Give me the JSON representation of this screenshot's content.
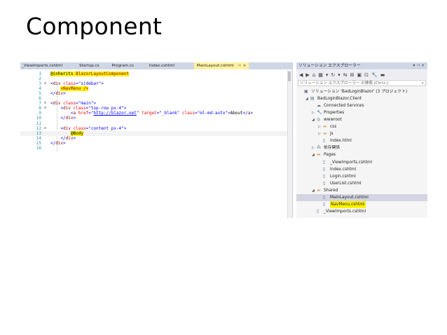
{
  "slide": {
    "title": "Component"
  },
  "editor": {
    "tabs": [
      {
        "label": "_ViewImports.cshtml",
        "active": false
      },
      {
        "label": "Startup.cs",
        "active": false
      },
      {
        "label": "Program.cs",
        "active": false
      },
      {
        "label": "Index.cshtml",
        "active": false
      },
      {
        "label": "MainLayout.cshtml",
        "active": true,
        "pin": "⊣",
        "close": "×"
      }
    ],
    "lines": [
      {
        "n": "1",
        "seg": [
          {
            "t": "@inherits ",
            "c": "kw-dir hl"
          },
          {
            "t": "BlazorLayoutComponent",
            "c": "tag hl"
          }
        ]
      },
      {
        "n": "2",
        "seg": []
      },
      {
        "n": "3",
        "fold": "⊟",
        "seg": [
          {
            "t": "<",
            "c": "str"
          },
          {
            "t": "div",
            "c": "tag"
          },
          {
            "t": " class",
            "c": "attr"
          },
          {
            "t": "=\"sidebar\"",
            "c": "str"
          },
          {
            "t": ">",
            "c": "str"
          }
        ]
      },
      {
        "n": "4",
        "seg": [
          {
            "t": "    ",
            "c": ""
          },
          {
            "t": "<NavMenu />",
            "c": "tag hl"
          }
        ]
      },
      {
        "n": "5",
        "seg": [
          {
            "t": "</",
            "c": "str"
          },
          {
            "t": "div",
            "c": "tag"
          },
          {
            "t": ">",
            "c": "str"
          }
        ]
      },
      {
        "n": "6",
        "seg": []
      },
      {
        "n": "7",
        "fold": "⊟",
        "seg": [
          {
            "t": "<",
            "c": "str"
          },
          {
            "t": "div",
            "c": "tag"
          },
          {
            "t": " class",
            "c": "attr"
          },
          {
            "t": "=\"main\"",
            "c": "str"
          },
          {
            "t": ">",
            "c": "str"
          }
        ]
      },
      {
        "n": "8",
        "fold": "⊟",
        "seg": [
          {
            "t": "    <",
            "c": "str"
          },
          {
            "t": "div",
            "c": "tag"
          },
          {
            "t": " class",
            "c": "attr"
          },
          {
            "t": "=\"top-row px-4\"",
            "c": "str"
          },
          {
            "t": ">",
            "c": "str"
          }
        ]
      },
      {
        "n": "9",
        "seg": [
          {
            "t": "        <",
            "c": "str"
          },
          {
            "t": "a",
            "c": "tag"
          },
          {
            "t": " href",
            "c": "attr"
          },
          {
            "t": "=\"",
            "c": "str"
          },
          {
            "t": "http://blazor.net",
            "c": "lnk"
          },
          {
            "t": "\"",
            "c": "str"
          },
          {
            "t": " target",
            "c": "attr"
          },
          {
            "t": "=\"_blank\"",
            "c": "str"
          },
          {
            "t": " class",
            "c": "attr"
          },
          {
            "t": "=\"ml-md-auto\"",
            "c": "str"
          },
          {
            "t": ">",
            "c": "str"
          },
          {
            "t": "About",
            "c": "kw-dir"
          },
          {
            "t": "</",
            "c": "str"
          },
          {
            "t": "a",
            "c": "tag"
          },
          {
            "t": ">",
            "c": "str"
          }
        ]
      },
      {
        "n": "10",
        "seg": [
          {
            "t": "    </",
            "c": "str"
          },
          {
            "t": "div",
            "c": "tag"
          },
          {
            "t": ">",
            "c": "str"
          }
        ]
      },
      {
        "n": "11",
        "seg": []
      },
      {
        "n": "12",
        "fold": "⊟",
        "seg": [
          {
            "t": "    <",
            "c": "str"
          },
          {
            "t": "div",
            "c": "tag"
          },
          {
            "t": " class",
            "c": "attr"
          },
          {
            "t": "=\"content px-4\"",
            "c": "str"
          },
          {
            "t": ">",
            "c": "str"
          }
        ]
      },
      {
        "n": "13",
        "cur": true,
        "seg": [
          {
            "t": "        ",
            "c": ""
          },
          {
            "t": "@Body",
            "c": "kw-dir hl"
          }
        ]
      },
      {
        "n": "14",
        "seg": [
          {
            "t": "    </",
            "c": "str"
          },
          {
            "t": "div",
            "c": "tag"
          },
          {
            "t": ">",
            "c": "str"
          }
        ]
      },
      {
        "n": "15",
        "seg": [
          {
            "t": "</",
            "c": "str"
          },
          {
            "t": "div",
            "c": "tag"
          },
          {
            "t": ">",
            "c": "str"
          }
        ]
      },
      {
        "n": "16",
        "seg": []
      }
    ]
  },
  "solution_explorer": {
    "title": "ソリューション エクスプローラー",
    "title_controls": "▾ ⊣ ×",
    "toolbar_icons": [
      "◀",
      "▶",
      "⌂",
      "▦",
      "▾",
      "↻",
      "▾",
      "⇆",
      "⊞",
      "▣",
      "⊡",
      "🔧",
      "▬"
    ],
    "search_placeholder": "ソリューション エクスプローラー の検索 (Ctrl+;)",
    "search_icon": "⌕",
    "nodes": [
      {
        "label": "ソリューション 'BadLoginBlazor' (3 プロジェクト)",
        "depth": 0,
        "arrow": "",
        "icon": "▣",
        "icon_name": "solution-icon",
        "hl": false
      },
      {
        "label": "BadLoginBlazor.Client",
        "depth": 1,
        "arrow": "◢",
        "icon": "▤",
        "icon_name": "project-icon",
        "hl": false
      },
      {
        "label": "Connected Services",
        "depth": 2,
        "arrow": "",
        "icon": "☁",
        "icon_name": "connected-services-icon",
        "hl": false
      },
      {
        "label": "Properties",
        "depth": 2,
        "arrow": "▷",
        "icon": "🔧",
        "icon_name": "wrench-icon",
        "hl": false
      },
      {
        "label": "wwwroot",
        "depth": 2,
        "arrow": "◢",
        "icon": "◎",
        "icon_name": "globe-icon",
        "hl": false
      },
      {
        "label": "css",
        "depth": 3,
        "arrow": "▷",
        "icon": "▬",
        "icon_name": "folder-icon",
        "hl": false
      },
      {
        "label": "js",
        "depth": 3,
        "arrow": "▷",
        "icon": "▬",
        "icon_name": "folder-icon",
        "hl": false
      },
      {
        "label": "index.html",
        "depth": 3,
        "arrow": "",
        "icon": "▯",
        "icon_name": "html-file-icon",
        "hl": false
      },
      {
        "label": "依存関係",
        "depth": 2,
        "arrow": "▷",
        "icon": "⁂",
        "icon_name": "dependencies-icon",
        "hl": false
      },
      {
        "label": "Pages",
        "depth": 2,
        "arrow": "◢",
        "icon": "▬",
        "icon_name": "folder-icon",
        "hl": false
      },
      {
        "label": "_ViewImports.cshtml",
        "depth": 3,
        "arrow": "",
        "icon": "▯",
        "icon_name": "cshtml-file-icon",
        "hl": false
      },
      {
        "label": "Index.cshtml",
        "depth": 3,
        "arrow": "",
        "icon": "▯",
        "icon_name": "cshtml-file-icon",
        "hl": false
      },
      {
        "label": "Login.cshtml",
        "depth": 3,
        "arrow": "",
        "icon": "▯",
        "icon_name": "cshtml-file-icon",
        "hl": false
      },
      {
        "label": "UserList.cshtml",
        "depth": 3,
        "arrow": "",
        "icon": "▯",
        "icon_name": "cshtml-file-icon",
        "hl": false
      },
      {
        "label": "Shared",
        "depth": 2,
        "arrow": "◢",
        "icon": "▬",
        "icon_name": "folder-icon",
        "hl": false
      },
      {
        "label": "MainLayout.cshtml",
        "depth": 3,
        "arrow": "",
        "icon": "▯",
        "icon_name": "cshtml-file-icon",
        "hl": false,
        "sel": true
      },
      {
        "label": "NavMenu.cshtml",
        "depth": 3,
        "arrow": "",
        "icon": "▯",
        "icon_name": "cshtml-file-icon",
        "hl": true
      },
      {
        "label": "_ViewImports.cshtml",
        "depth": 2,
        "arrow": "",
        "icon": "▯",
        "icon_name": "cshtml-file-icon",
        "hl": false
      }
    ]
  }
}
